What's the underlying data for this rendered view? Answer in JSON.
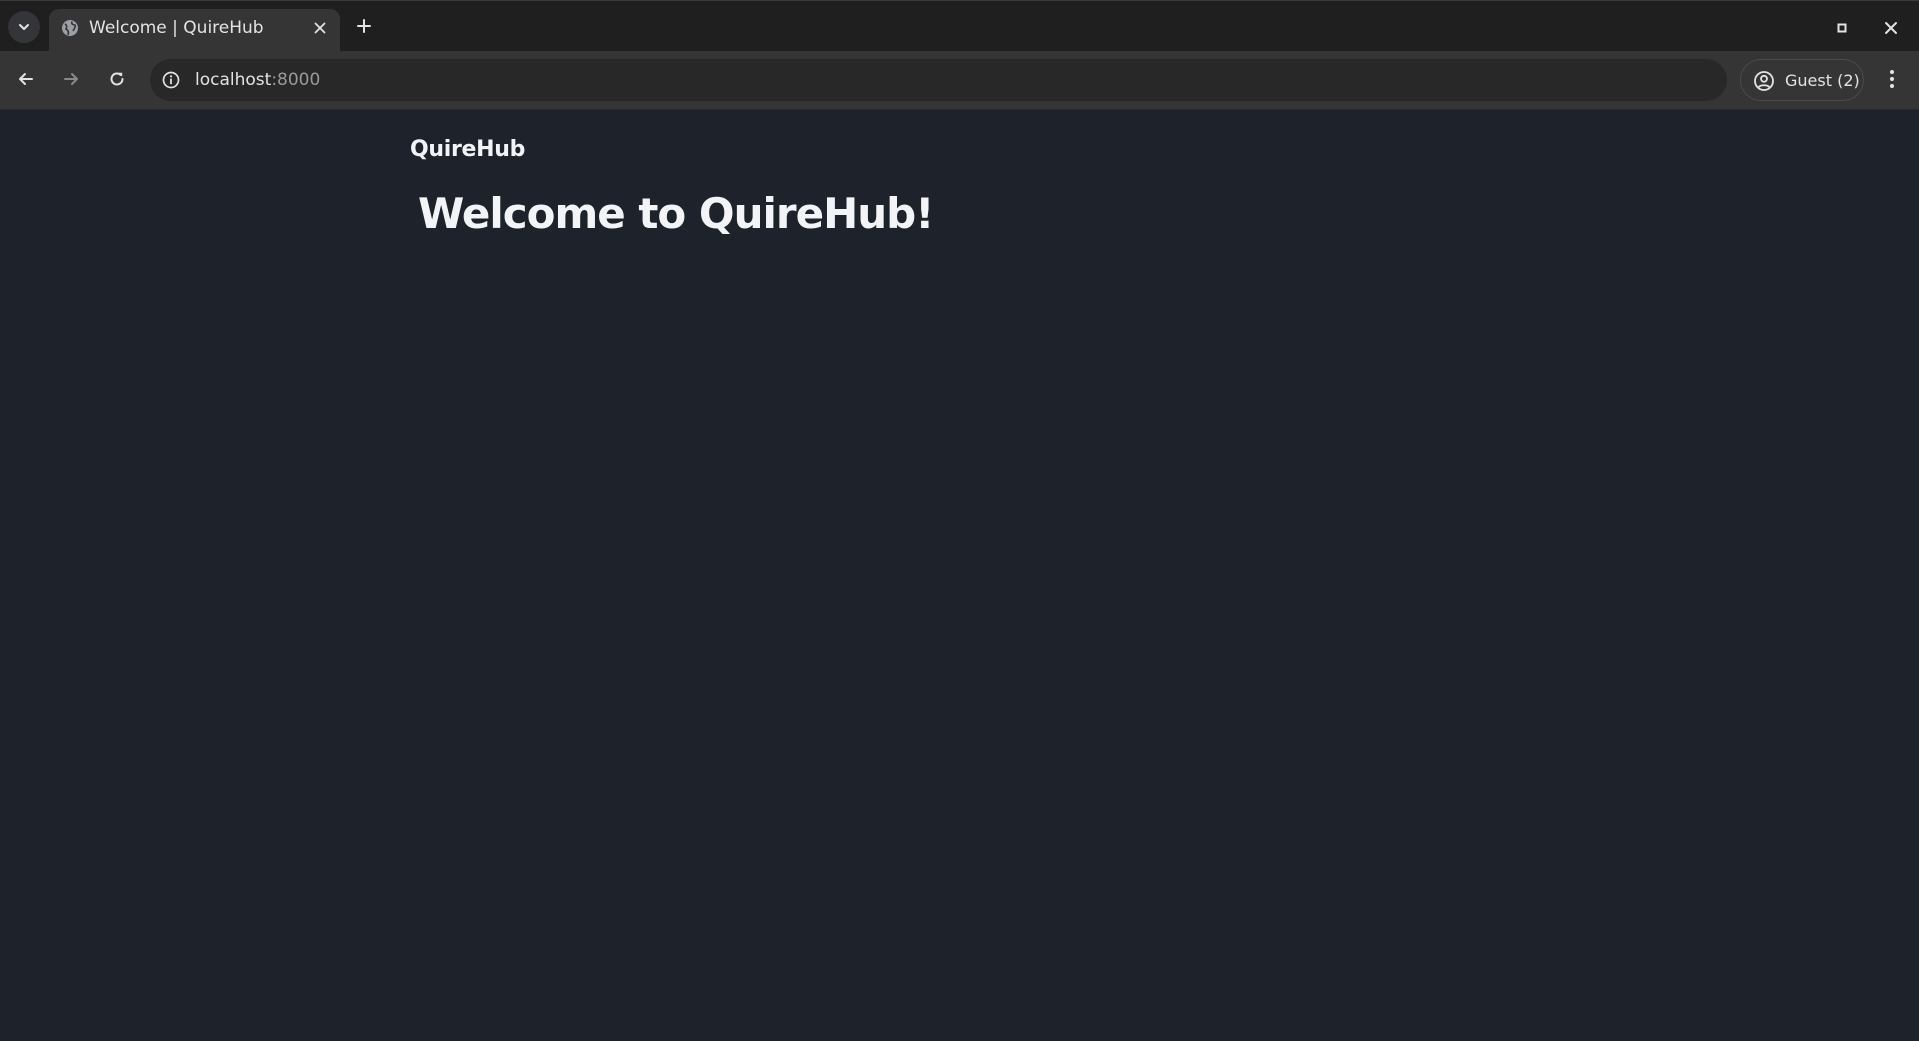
{
  "browser": {
    "tab": {
      "title": "Welcome | QuireHub",
      "favicon": "globe-icon"
    },
    "address_bar": {
      "host": "localhost",
      "port": ":8000"
    },
    "profile": {
      "label": "Guest (2)",
      "icon": "account-circle-icon"
    },
    "icons": {
      "tab_search": "chevron-down-icon",
      "tab_close": "close-icon",
      "new_tab": "plus-icon",
      "back": "arrow-left-icon",
      "forward": "arrow-right-icon",
      "reload": "reload-icon",
      "site_info": "info-icon",
      "menu": "kebab-menu-icon",
      "window_restore": "restore-icon",
      "window_close": "close-icon"
    }
  },
  "page": {
    "brand": "QuireHub",
    "headline": "Welcome to QuireHub!"
  },
  "colors": {
    "page_background": "#1d222b",
    "text": "#f2f4f7",
    "tabstrip": "#1f1f1f",
    "toolbar": "#353535",
    "omnibox": "#282828"
  }
}
